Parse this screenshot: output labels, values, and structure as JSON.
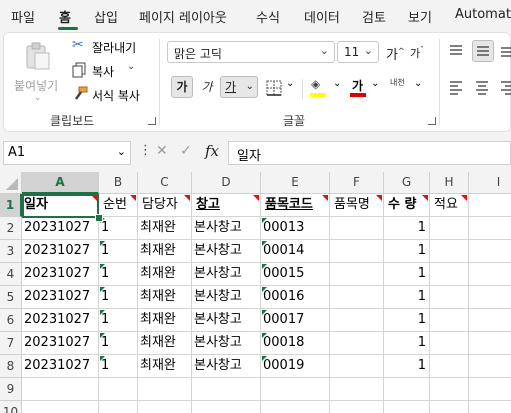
{
  "menu": [
    "파일",
    "홈",
    "삽입",
    "페이지 레이아웃",
    "수식",
    "데이터",
    "검토",
    "보기",
    "Automate"
  ],
  "clipboard": {
    "paste": "붙여넣기",
    "cut": "잘라내기",
    "copy": "복사",
    "format_painter": "서식 복사",
    "label": "클립보드"
  },
  "font": {
    "name": "맑은 고딕",
    "size": "11",
    "grow": "가",
    "shrink": "가",
    "bold": "가",
    "italic": "가",
    "underline": "가",
    "font_color_label": "가",
    "phonetic": "내천",
    "label": "글꼴",
    "fill_color": "#ffff00",
    "font_color": "#e00000"
  },
  "formula_bar": {
    "name_box": "A1",
    "content": "일자"
  },
  "sheet": {
    "columns": [
      "A",
      "B",
      "C",
      "D",
      "E",
      "F",
      "G",
      "H",
      "I"
    ],
    "rows": [
      "1",
      "2",
      "3",
      "4",
      "5",
      "6",
      "7",
      "8",
      "9",
      "10"
    ],
    "header": [
      "일자",
      "순번",
      "담당자",
      "창고",
      "품목코드",
      "품목명",
      "수 량",
      "적요"
    ],
    "data": [
      [
        "20231027",
        "1",
        "최재완",
        "본사창고",
        "00013",
        "",
        "1",
        ""
      ],
      [
        "20231027",
        "1",
        "최재완",
        "본사창고",
        "00014",
        "",
        "1",
        ""
      ],
      [
        "20231027",
        "1",
        "최재완",
        "본사창고",
        "00015",
        "",
        "1",
        ""
      ],
      [
        "20231027",
        "1",
        "최재완",
        "본사창고",
        "00016",
        "",
        "1",
        ""
      ],
      [
        "20231027",
        "1",
        "최재완",
        "본사창고",
        "00017",
        "",
        "1",
        ""
      ],
      [
        "20231027",
        "1",
        "최재완",
        "본사창고",
        "00018",
        "",
        "1",
        ""
      ],
      [
        "20231027",
        "1",
        "최재완",
        "본사창고",
        "00019",
        "",
        "1",
        ""
      ]
    ]
  },
  "colors": {
    "accent": "#1e7145"
  }
}
